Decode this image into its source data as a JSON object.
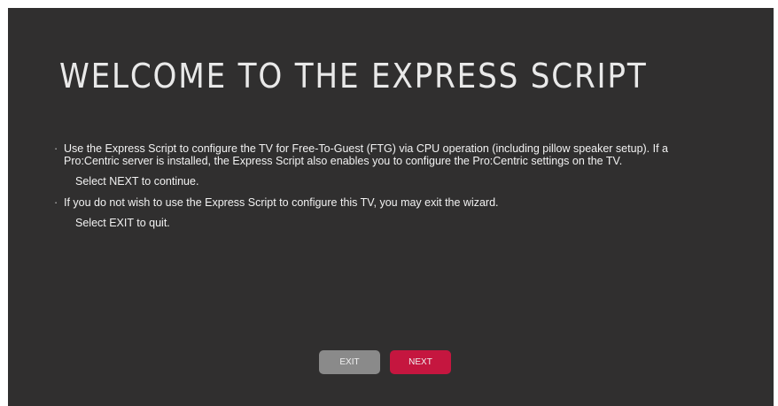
{
  "title": "WELCOME TO THE EXPRESS SCRIPT",
  "bullet_char": "·",
  "paragraphs": [
    {
      "text": "Use the Express Script to configure the TV for Free-To-Guest (FTG) via CPU operation (including pillow speaker setup). If a Pro:Centric server is installed, the Express Script also enables you to configure the Pro:Centric settings on the TV.",
      "sub": "Select NEXT to continue."
    },
    {
      "text": "If you do not wish to use the Express Script to configure this TV, you may exit the wizard.",
      "sub": "Select EXIT to quit."
    }
  ],
  "buttons": {
    "exit_label": "EXIT",
    "next_label": "NEXT"
  },
  "colors": {
    "background": "#302f2f",
    "exit_button": "#8a8a8a",
    "next_button": "#c5163f"
  }
}
